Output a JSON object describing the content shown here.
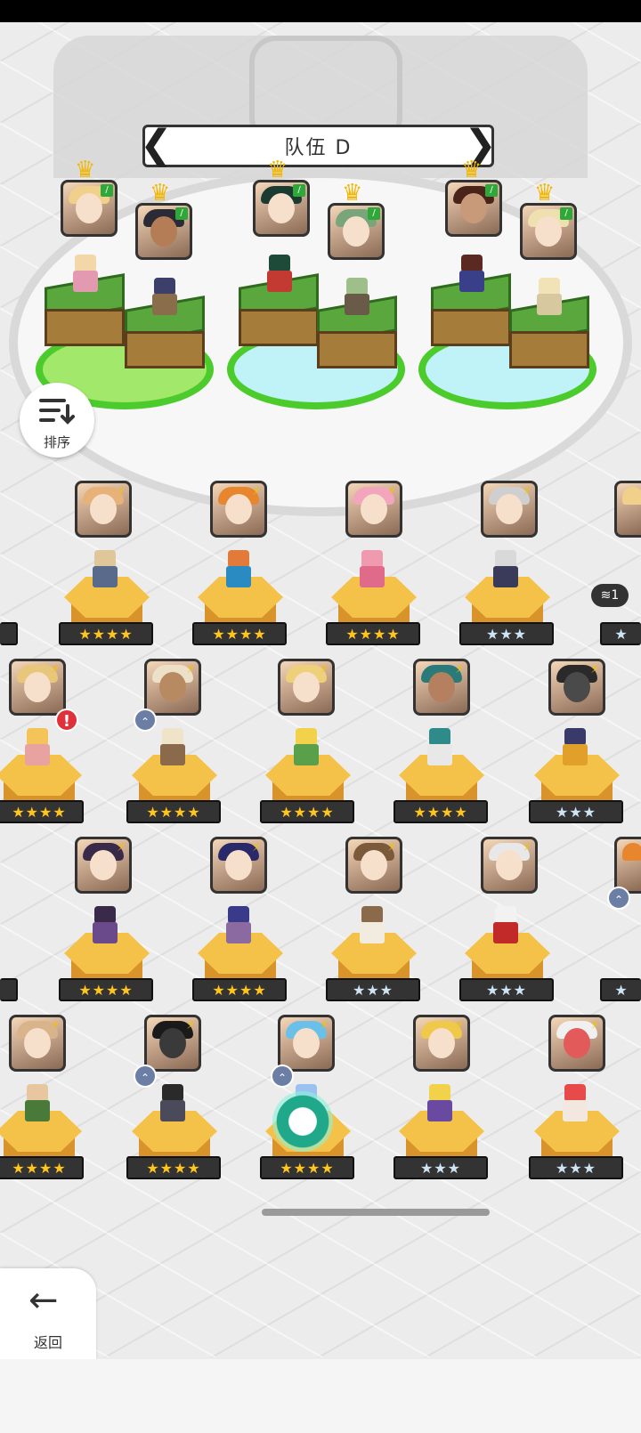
{
  "team": {
    "name": "队伍 D"
  },
  "sort_button": {
    "label": "排序",
    "icon": "sort-list-icon"
  },
  "back_button": {
    "label": "返回",
    "icon": "arrow-left-icon"
  },
  "stack_badge": {
    "count": "1"
  },
  "colors": {
    "accent_green": "#4ccc2c",
    "gold_star": "#ffc51c",
    "silver_star": "#cfe4f2",
    "alert": "#e0313a"
  },
  "stars": {
    "four": "★★★★",
    "three": "★★★"
  },
  "glyphs": {
    "crown": "♛",
    "leaf": "/",
    "bolt": "⚡",
    "chev_left": "❮",
    "chev_right": "❯",
    "arrow_left": "←",
    "exclaim": "!",
    "up": "⌃"
  },
  "roster": [
    {
      "id": "hero-r1-1",
      "rank": 4
    },
    {
      "id": "hero-r1-2",
      "rank": 4
    },
    {
      "id": "hero-r1-3",
      "rank": 4
    },
    {
      "id": "hero-r1-4",
      "rank": 3
    },
    {
      "id": "hero-r2-1",
      "rank": 4,
      "alert": true
    },
    {
      "id": "hero-r2-2",
      "rank": 4,
      "upgrade": true
    },
    {
      "id": "hero-r2-3",
      "rank": 4
    },
    {
      "id": "hero-r2-4",
      "rank": 4
    },
    {
      "id": "hero-r2-5",
      "rank": 3
    },
    {
      "id": "hero-r3-1",
      "rank": 4
    },
    {
      "id": "hero-r3-2",
      "rank": 4
    },
    {
      "id": "hero-r3-3",
      "rank": 3
    },
    {
      "id": "hero-r3-4",
      "rank": 3
    },
    {
      "id": "hero-r4-1",
      "rank": 4
    },
    {
      "id": "hero-r4-2",
      "rank": 4,
      "upgrade": true
    },
    {
      "id": "hero-r4-3",
      "rank": 4,
      "upgrade": true
    },
    {
      "id": "hero-r4-4",
      "rank": 3
    },
    {
      "id": "hero-r4-5",
      "rank": 3
    }
  ]
}
